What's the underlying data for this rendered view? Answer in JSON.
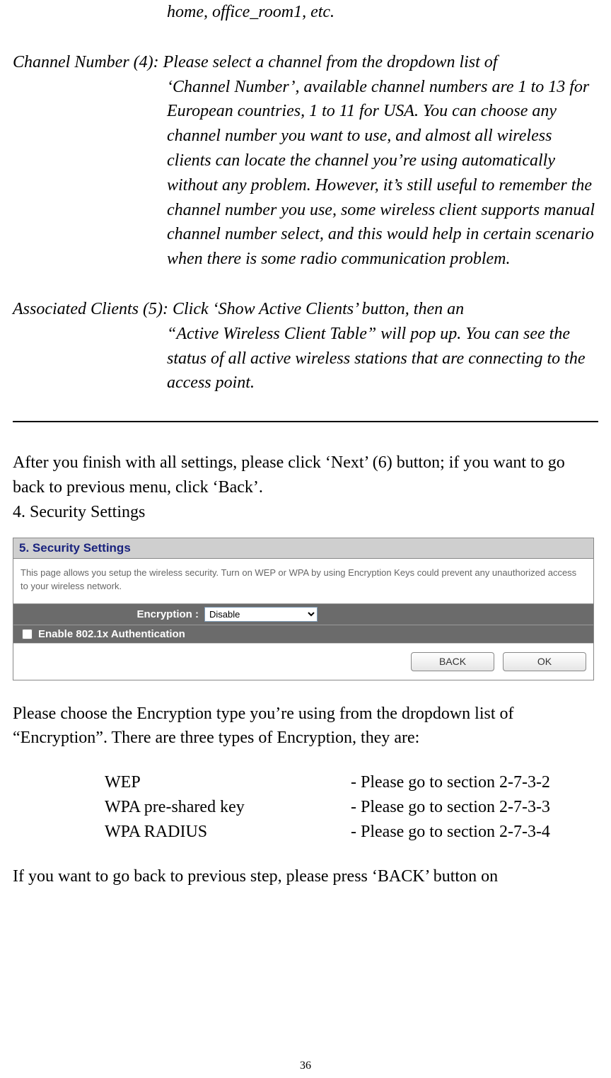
{
  "top_line": "home, office_room1, etc.",
  "defs": {
    "channel": {
      "label": "Channel Number (4): ",
      "first": "Please select a channel from the dropdown list of",
      "rest": "‘Channel Number’, available channel numbers are 1 to 13 for European countries, 1 to 11 for USA. You can choose any channel number you want to use, and almost all wireless clients can locate the channel you’re using automatically without any problem. However, it’s still useful to remember the channel number you use, some wireless client supports manual channel number select, and this would help in certain scenario when there is some radio communication problem."
    },
    "associated": {
      "label": "Associated Clients (5): ",
      "first": "Click ‘Show Active Clients’ button, then an",
      "rest": "“Active Wireless Client Table” will pop up. You can see the status of all active wireless stations that are connecting to the access point."
    }
  },
  "after_settings": "After you finish with all settings, please click ‘Next’ (6) button; if you want to go back to previous menu, click ‘Back’.",
  "section4": "4. Security Settings",
  "ui": {
    "title": "5. Security Settings",
    "description": "This page allows you setup the wireless security. Turn on WEP or WPA by using Encryption Keys could prevent any unauthorized access to your wireless network.",
    "encryption_label": "Encryption :",
    "encryption_value": "Disable",
    "enable_8021x_label": "Enable 802.1x Authentication",
    "back_button": "BACK",
    "ok_button": "OK"
  },
  "encryption_intro": "Please choose the Encryption type you’re using from the dropdown list of “Encryption”. There are three types of Encryption, they are:",
  "enc_options": [
    {
      "name": "WEP",
      "ref": "- Please go to section 2-7-3-2"
    },
    {
      "name": "WPA pre-shared key",
      "ref": "- Please go to section 2-7-3-3"
    },
    {
      "name": "WPA RADIUS",
      "ref": "- Please go to section 2-7-3-4"
    }
  ],
  "back_note": "If you want to go back to previous step, please press ‘BACK’ button on",
  "page_number": "36"
}
